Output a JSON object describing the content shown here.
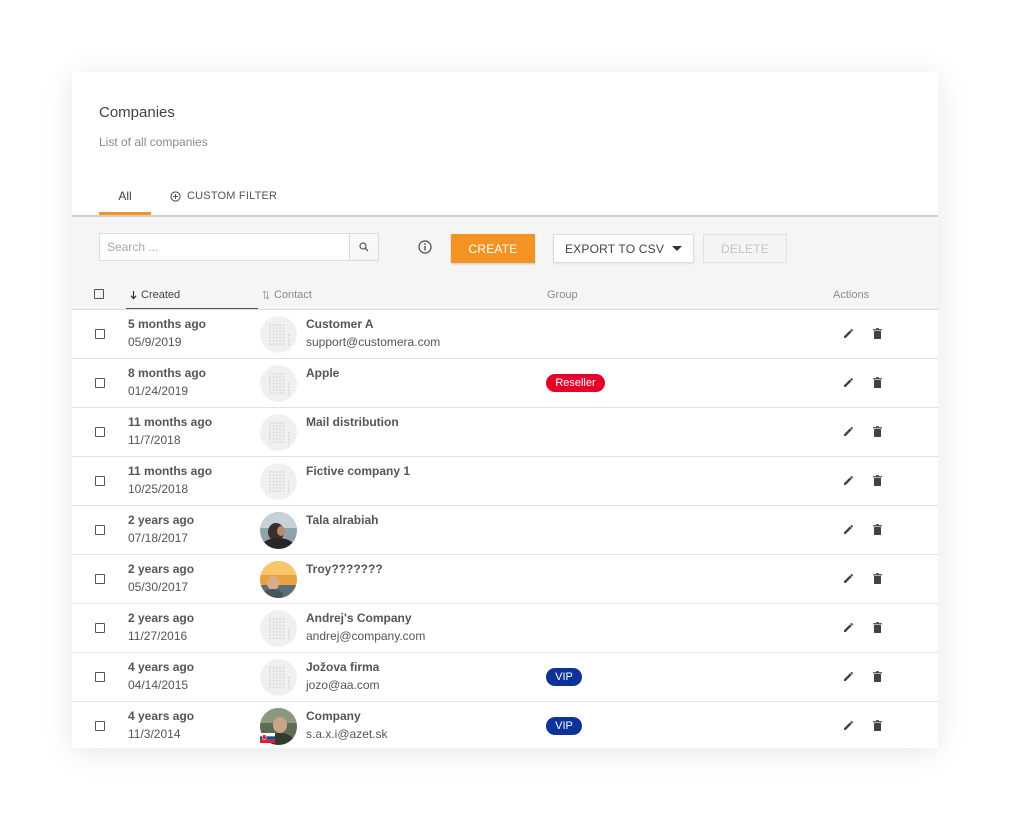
{
  "header": {
    "title": "Companies",
    "subtitle": "List of all companies",
    "tabs": [
      {
        "label": "All",
        "active": true
      },
      {
        "label": "CUSTOM FILTER",
        "icon": "plus-circle-icon"
      }
    ]
  },
  "toolbar": {
    "search_placeholder": "Search ...",
    "create_label": "CREATE",
    "export_label": "EXPORT TO CSV",
    "delete_label": "DELETE"
  },
  "table": {
    "columns": {
      "created": "Created",
      "contact": "Contact",
      "group": "Group",
      "actions": "Actions"
    },
    "rows": [
      {
        "relative": "5 months ago",
        "date": "05/9/2019",
        "name": "Customer A",
        "email": "support@customera.com",
        "group": "",
        "avatar": "building"
      },
      {
        "relative": "8 months ago",
        "date": "01/24/2019",
        "name": "Apple",
        "email": "",
        "group": "Reseller",
        "avatar": "building"
      },
      {
        "relative": "11 months ago",
        "date": "11/7/2018",
        "name": "Mail distribution",
        "email": "",
        "group": "",
        "avatar": "building"
      },
      {
        "relative": "11 months ago",
        "date": "10/25/2018",
        "name": "Fictive company 1",
        "email": "",
        "group": "",
        "avatar": "building"
      },
      {
        "relative": "2 years ago",
        "date": "07/18/2017",
        "name": "Tala alrabiah",
        "email": "",
        "group": "",
        "avatar": "photo-person"
      },
      {
        "relative": "2 years ago",
        "date": "05/30/2017",
        "name": "Troy???????",
        "email": "",
        "group": "",
        "avatar": "photo-sunset"
      },
      {
        "relative": "2 years ago",
        "date": "11/27/2016",
        "name": "Andrej's Company",
        "email": "andrej@company.com",
        "group": "",
        "avatar": "building"
      },
      {
        "relative": "4 years ago",
        "date": "04/14/2015",
        "name": "Jožova firma",
        "email": "jozo@aa.com",
        "group": "VIP",
        "avatar": "building"
      },
      {
        "relative": "4 years ago",
        "date": "11/3/2014",
        "name": "Company",
        "email": "s.a.x.i@azet.sk",
        "group": "VIP",
        "avatar": "photo-man-flag"
      }
    ]
  },
  "colors": {
    "accent": "#f39323",
    "reseller_badge": "#e4002b",
    "vip_badge": "#0d3399"
  }
}
